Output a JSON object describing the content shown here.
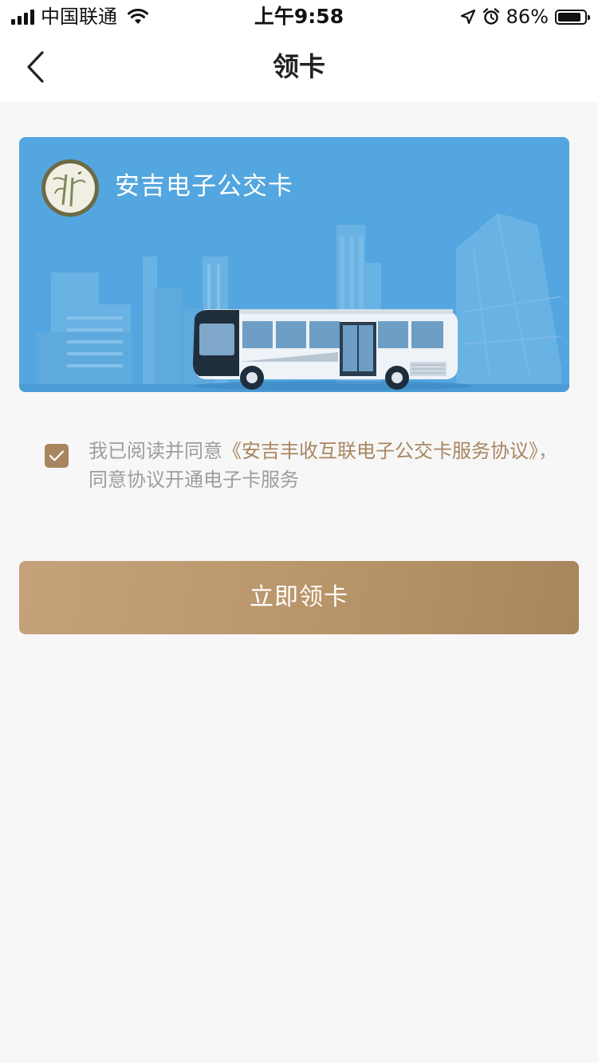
{
  "status_bar": {
    "carrier": "中国联通",
    "time": "上午9:58",
    "battery_percent": "86%",
    "battery_level": 0.86,
    "icons": [
      "signal-icon",
      "wifi-icon",
      "location-arrow-icon",
      "alarm-icon",
      "battery-icon"
    ]
  },
  "nav": {
    "title": "领卡",
    "back_icon": "chevron-left-icon"
  },
  "card": {
    "title": "安吉电子公交卡",
    "logo_icon": "bamboo-emblem-icon",
    "colors": {
      "background": "#53a6df",
      "skyline": "#6fb6e6"
    }
  },
  "agreement": {
    "checked": true,
    "prefix": "我已阅读并同意",
    "link_text": "《安吉丰收互联电子公交卡服务协议》",
    "suffix": "，同意协议开通电子卡服务"
  },
  "cta": {
    "label": "立即领卡",
    "color": "#b89569"
  }
}
